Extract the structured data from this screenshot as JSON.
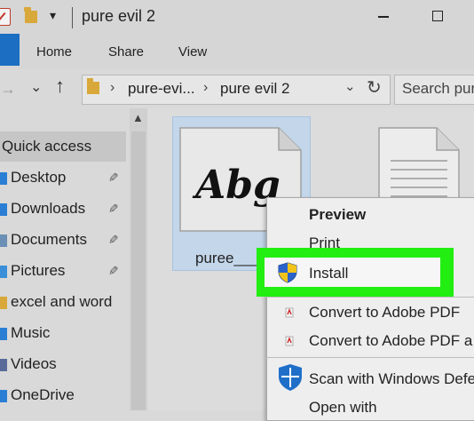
{
  "window": {
    "title": "pure evil 2",
    "qat_dropdown": "▾"
  },
  "ribbon": {
    "tabs": [
      "Home",
      "Share",
      "View"
    ]
  },
  "address": {
    "crumbs": [
      "pure-evi...",
      "pure evil 2"
    ],
    "separator": "›",
    "search_placeholder": "Search pur"
  },
  "nav": {
    "quick_access": "Quick access",
    "items": [
      {
        "label": "Desktop",
        "icon": "desktop-icon",
        "pinned": true,
        "color": "#2a7fd4"
      },
      {
        "label": "Downloads",
        "icon": "downloads-icon",
        "pinned": true,
        "color": "#2a7fd4"
      },
      {
        "label": "Documents",
        "icon": "documents-icon",
        "pinned": true,
        "color": "#6b8fb5"
      },
      {
        "label": "Pictures",
        "icon": "pictures-icon",
        "pinned": true,
        "color": "#3a8fd8"
      },
      {
        "label": "excel and word",
        "icon": "folder-icon",
        "pinned": false,
        "color": "#d8a93a"
      },
      {
        "label": "Music",
        "icon": "music-icon",
        "pinned": false,
        "color": "#2a7fd4"
      },
      {
        "label": "Videos",
        "icon": "videos-icon",
        "pinned": false,
        "color": "#5a6b9a"
      },
      {
        "label": "OneDrive",
        "icon": "onedrive-icon",
        "pinned": false,
        "color": "#2a7fd4"
      }
    ],
    "pin_glyph": "📌"
  },
  "files": {
    "selected_label": "puree___",
    "font_preview": "Abg"
  },
  "context_menu": {
    "preview": "Preview",
    "print": "Print",
    "install": "Install",
    "convert_pdf": "Convert to Adobe PDF",
    "convert_pdf_and": "Convert to Adobe PDF a",
    "scan": "Scan with Windows Defe",
    "open_with": "Open with"
  },
  "colors": {
    "highlight": "#22ee11",
    "selection": "#c3d6ea",
    "file_tab": "#1b6ec2"
  }
}
